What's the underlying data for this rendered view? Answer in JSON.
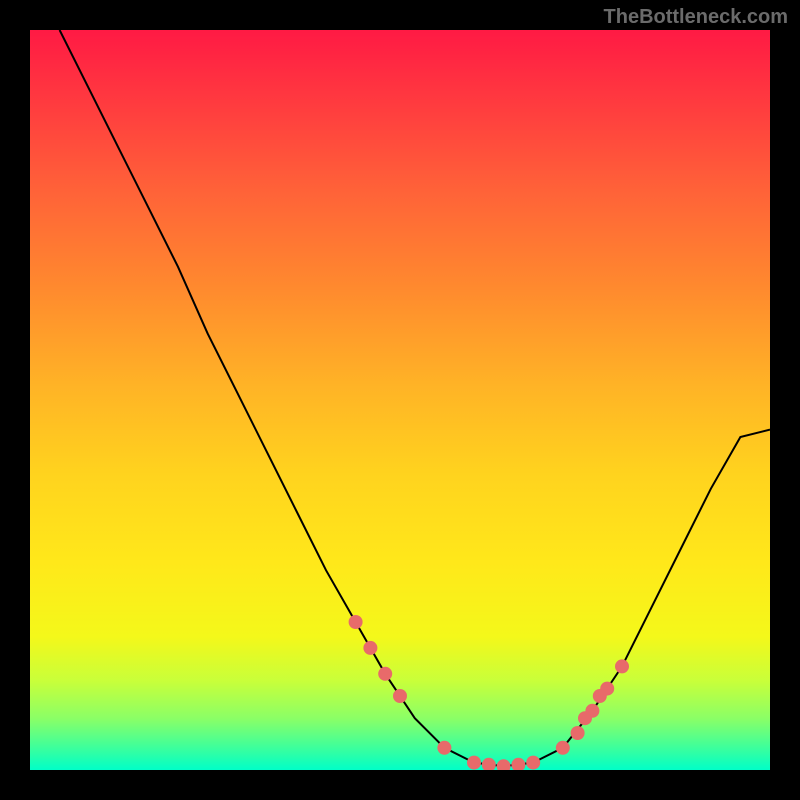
{
  "attribution": "TheBottleneck.com",
  "chart_data": {
    "type": "line",
    "title": "",
    "xlabel": "",
    "ylabel": "",
    "xlim": [
      0,
      100
    ],
    "ylim": [
      0,
      100
    ],
    "curve": [
      {
        "x": 4,
        "y": 100
      },
      {
        "x": 8,
        "y": 92
      },
      {
        "x": 12,
        "y": 84
      },
      {
        "x": 16,
        "y": 76
      },
      {
        "x": 20,
        "y": 68
      },
      {
        "x": 24,
        "y": 59
      },
      {
        "x": 28,
        "y": 51
      },
      {
        "x": 32,
        "y": 43
      },
      {
        "x": 36,
        "y": 35
      },
      {
        "x": 40,
        "y": 27
      },
      {
        "x": 44,
        "y": 20
      },
      {
        "x": 48,
        "y": 13
      },
      {
        "x": 52,
        "y": 7
      },
      {
        "x": 56,
        "y": 3
      },
      {
        "x": 60,
        "y": 1
      },
      {
        "x": 64,
        "y": 0.5
      },
      {
        "x": 68,
        "y": 1
      },
      {
        "x": 72,
        "y": 3
      },
      {
        "x": 76,
        "y": 8
      },
      {
        "x": 80,
        "y": 14
      },
      {
        "x": 84,
        "y": 22
      },
      {
        "x": 88,
        "y": 30
      },
      {
        "x": 92,
        "y": 38
      },
      {
        "x": 96,
        "y": 45
      },
      {
        "x": 100,
        "y": 46
      }
    ],
    "markers": [
      {
        "x": 44,
        "y": 20
      },
      {
        "x": 46,
        "y": 16.5
      },
      {
        "x": 48,
        "y": 13
      },
      {
        "x": 50,
        "y": 10
      },
      {
        "x": 56,
        "y": 3
      },
      {
        "x": 60,
        "y": 1
      },
      {
        "x": 62,
        "y": 0.7
      },
      {
        "x": 64,
        "y": 0.5
      },
      {
        "x": 66,
        "y": 0.7
      },
      {
        "x": 68,
        "y": 1
      },
      {
        "x": 72,
        "y": 3
      },
      {
        "x": 74,
        "y": 5
      },
      {
        "x": 75,
        "y": 7
      },
      {
        "x": 76,
        "y": 8
      },
      {
        "x": 77,
        "y": 10
      },
      {
        "x": 78,
        "y": 11
      },
      {
        "x": 80,
        "y": 14
      }
    ],
    "marker_color": "#e86a6a",
    "curve_color": "#000000"
  }
}
